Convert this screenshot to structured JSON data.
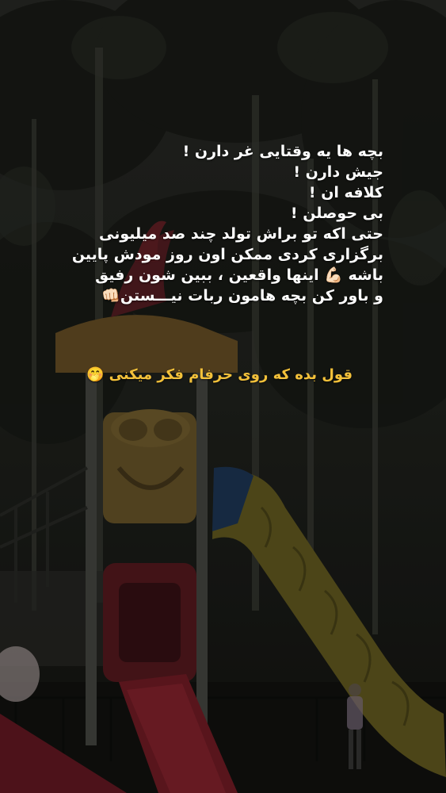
{
  "story": {
    "lines": [
      "بچه ها یه وقتایی غر دارن !",
      "جیش دارن !",
      "کلافه ان !",
      "بی حوصلن !",
      "حتی اکه تو براش تولد چند صد میلیونی",
      "برگزاری کردی ممکن اون روز مودش پایین",
      "باشه 💪🏻 اینها واقعین ، ببین شون رفیق",
      "و باور کن بچه هامون ربات نیـــستن👊🏻"
    ],
    "closing": "قول بده که روی حرفام فکر میکنی 🤭",
    "closing_color": "#f3c13a",
    "text_color": "#ffffff"
  }
}
